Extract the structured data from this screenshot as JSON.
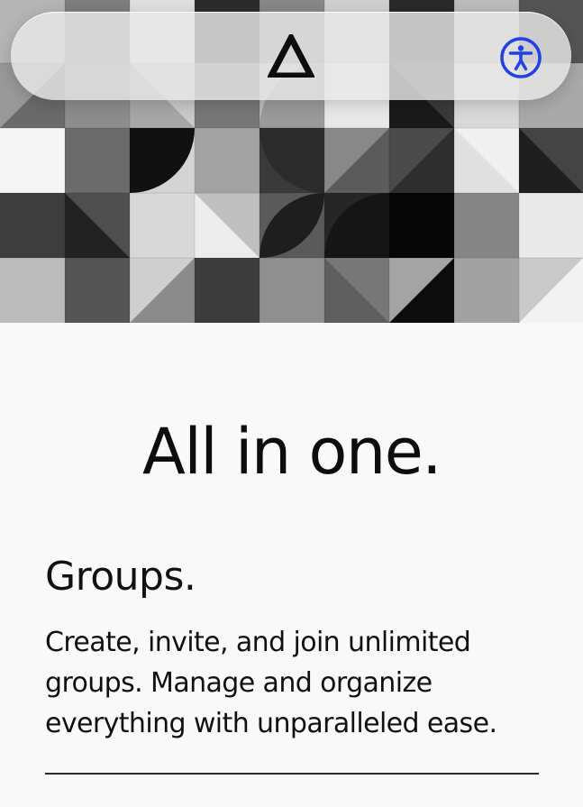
{
  "header": {
    "logo_icon": "triangle-logo-icon",
    "accessibility_icon": "accessibility-icon",
    "accent_color": "#2340e6"
  },
  "hero": {
    "pattern": "grayscale-geometric-tiles"
  },
  "main": {
    "headline": "All in one.",
    "feature": {
      "title": "Groups.",
      "description": "Create, invite, and join unlimited groups. Manage and organize everything with unparalleled ease."
    }
  }
}
